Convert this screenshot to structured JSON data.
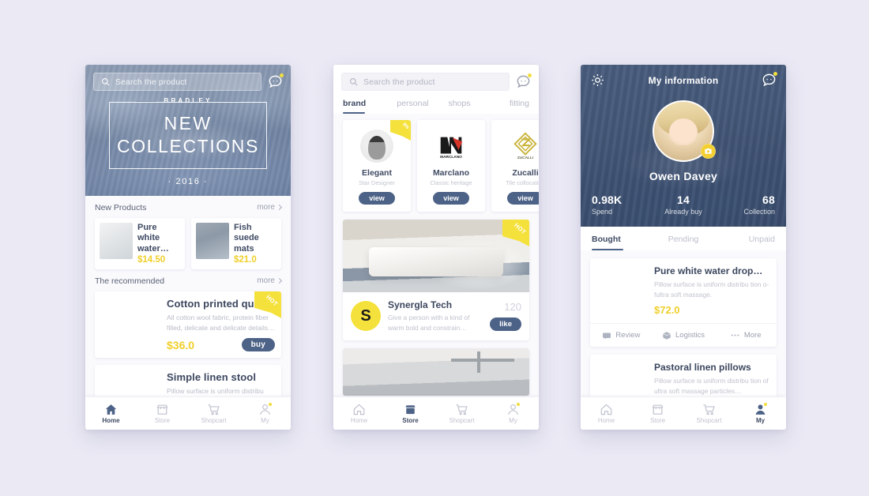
{
  "canvas": {
    "background": "#eae9f4"
  },
  "colors": {
    "navy": "#4d6287",
    "yellow": "#f3de3e",
    "price_yellow": "#f0cf2a",
    "title_dark": "#3c475f",
    "muted": "#bfc2cd"
  },
  "phone1": {
    "search": {
      "placeholder": "Search the product",
      "icon": "search-icon",
      "chat_icon": "chat-bubble-icon"
    },
    "hero": {
      "brand": "BRADLEY",
      "line1": "NEW",
      "line2": "COLLECTIONS",
      "year": "· 2016 ·"
    },
    "sections": [
      {
        "title": "New Products",
        "more": "more"
      },
      {
        "title": "The recommended",
        "more": "more"
      }
    ],
    "new_products": [
      {
        "title": "Pure white water…",
        "price": "$14.50",
        "thumb": "jars"
      },
      {
        "title": "Fish suede mats",
        "price": "$21.0",
        "thumb": "mats"
      }
    ],
    "recommended": {
      "title": "Cotton printed quilt",
      "desc": "All cotton wool fabric, protein fiber filled, delicate and delicate details…",
      "price": "$36.0",
      "action": "buy",
      "badge": "HOT"
    },
    "next_item": {
      "title": "Simple linen stool",
      "desc": "Pillow surface is uniform distribu tion"
    },
    "tabbar": [
      {
        "label": "Home",
        "icon": "home-icon",
        "active": true
      },
      {
        "label": "Store",
        "icon": "store-icon",
        "active": false
      },
      {
        "label": "Shopcart",
        "icon": "cart-icon",
        "active": false
      },
      {
        "label": "My",
        "icon": "user-icon",
        "active": false
      }
    ]
  },
  "phone2": {
    "search": {
      "placeholder": "Search the product",
      "icon": "search-icon",
      "chat_icon": "chat-bubble-icon"
    },
    "tabs": [
      {
        "label": "brand",
        "active": true
      },
      {
        "label": "personal",
        "active": false
      },
      {
        "label": "shops",
        "active": false
      },
      {
        "label": "fitting",
        "active": false
      }
    ],
    "brands": [
      {
        "name": "Elegant",
        "sub": "Star Designer",
        "action": "view",
        "badge": "9%",
        "logo_type": "face"
      },
      {
        "name": "Marclano",
        "sub": "Classic heritage",
        "action": "view",
        "badge": "",
        "logo_type": "MARCLANO"
      },
      {
        "name": "Zucalli",
        "sub": "Tile collocation",
        "action": "view",
        "badge": "",
        "logo_type": "ZUCALLI"
      }
    ],
    "feed": {
      "badge": "HOT",
      "title": "Synergla Tech",
      "desc": "Give a person with a kind of warm bold and constrain…",
      "count": "120",
      "action": "like",
      "logo_glyph": "S"
    },
    "tabbar": [
      {
        "label": "Home",
        "icon": "home-icon",
        "active": false
      },
      {
        "label": "Store",
        "icon": "store-icon",
        "active": true
      },
      {
        "label": "Shopcart",
        "icon": "cart-icon",
        "active": false
      },
      {
        "label": "My",
        "icon": "user-icon",
        "active": false
      }
    ]
  },
  "phone3": {
    "header": {
      "title": "My information",
      "gear_icon": "gear-icon",
      "chat_icon": "chat-bubble-icon"
    },
    "profile": {
      "name": "Owen Davey",
      "camera_badge_icon": "camera-icon"
    },
    "stats": [
      {
        "value": "0.98K",
        "label": "Spend"
      },
      {
        "value": "14",
        "label": "Already buy"
      },
      {
        "value": "68",
        "label": "Collection"
      }
    ],
    "tabs": [
      {
        "label": "Bought",
        "active": true
      },
      {
        "label": "Pending",
        "active": false
      },
      {
        "label": "Unpaid",
        "active": false
      }
    ],
    "orders": [
      {
        "title": "Pure white water drop…",
        "desc": "Pillow surface is uniform distribu tion o- fultra soft massage.",
        "price": "$72.0",
        "thumb": "jars",
        "actions": [
          {
            "label": "Review",
            "icon": "comment-icon"
          },
          {
            "label": "Logistics",
            "icon": "box-icon"
          },
          {
            "label": "More",
            "icon": "ellipsis-icon"
          }
        ]
      },
      {
        "title": "Pastoral linen pillows",
        "desc": "Pillow surface is uniform distribu tion of ultra soft massage particles…",
        "price": "",
        "thumb": "pillow",
        "actions": []
      }
    ],
    "tabbar": [
      {
        "label": "Home",
        "icon": "home-icon",
        "active": false
      },
      {
        "label": "Store",
        "icon": "store-icon",
        "active": false
      },
      {
        "label": "Shopcart",
        "icon": "cart-icon",
        "active": false
      },
      {
        "label": "My",
        "icon": "user-icon",
        "active": true
      }
    ]
  }
}
